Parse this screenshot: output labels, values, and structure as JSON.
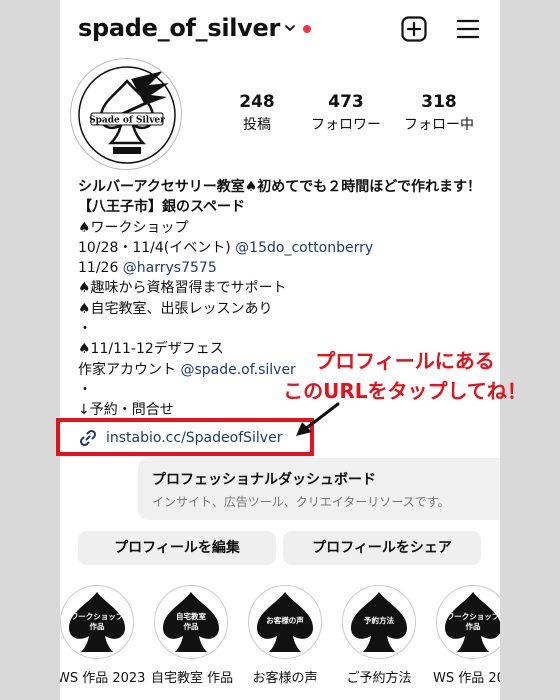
{
  "header": {
    "username": "spade_of_silver",
    "notification_dot_color": "#ff3040"
  },
  "avatar": {
    "logo_text": "Spade of Silver",
    "logo_subtext": "銀のスペード"
  },
  "stats": [
    {
      "number": "248",
      "label": "投稿"
    },
    {
      "number": "473",
      "label": "フォロワー"
    },
    {
      "number": "318",
      "label": "フォロー中"
    }
  ],
  "bio": {
    "name_line": "シルバーアクセサリー教室♠初めてでも２時間ほどで作れます！【八王子市】銀のスペード",
    "line_workshop": "♠ワークショップ",
    "line_event_text": "10/28・11/4(イベント) ",
    "line_event_mention": "@15do_cottonberry",
    "line_1126_text": "11/26 ",
    "line_1126_mention": "@harrys7575",
    "line_hobby": "♠趣味から資格習得までサポート",
    "line_home": "♠自宅教室、出張レッスンあり",
    "dot1": "・",
    "line_fes": "♠11/11-12デザフェス",
    "line_artist_text": "作家アカウント ",
    "line_artist_mention": "@spade.of.silver",
    "dot2": "・",
    "line_reserve": "↓予約・問合せ",
    "link": "instabio.cc/SpadeofSilver"
  },
  "annotation": {
    "line1": "プロフィールにある",
    "line2": "このURLをタップしてね！",
    "color": "#e8101a"
  },
  "dashboard": {
    "title": "プロフェッショナルダッシュボード",
    "subtitle": "インサイト、広告ツール、クリエイターリソースです。"
  },
  "buttons": {
    "edit": "プロフィールを編集",
    "share": "プロフィールをシェア"
  },
  "highlights": [
    {
      "icon_text_1": "ワークショップ",
      "icon_text_2": "作品",
      "label": "WS 作品 2023"
    },
    {
      "icon_text_1": "自宅教室",
      "icon_text_2": "作品",
      "label": "自宅教室 作品"
    },
    {
      "icon_text_1": "お客様の声",
      "icon_text_2": "",
      "label": "お客様の声"
    },
    {
      "icon_text_1": "予約方法",
      "icon_text_2": "",
      "label": "ご予約方法"
    },
    {
      "icon_text_1": "ワークショップ",
      "icon_text_2": "作品",
      "label": "WS 作品 2022"
    }
  ]
}
